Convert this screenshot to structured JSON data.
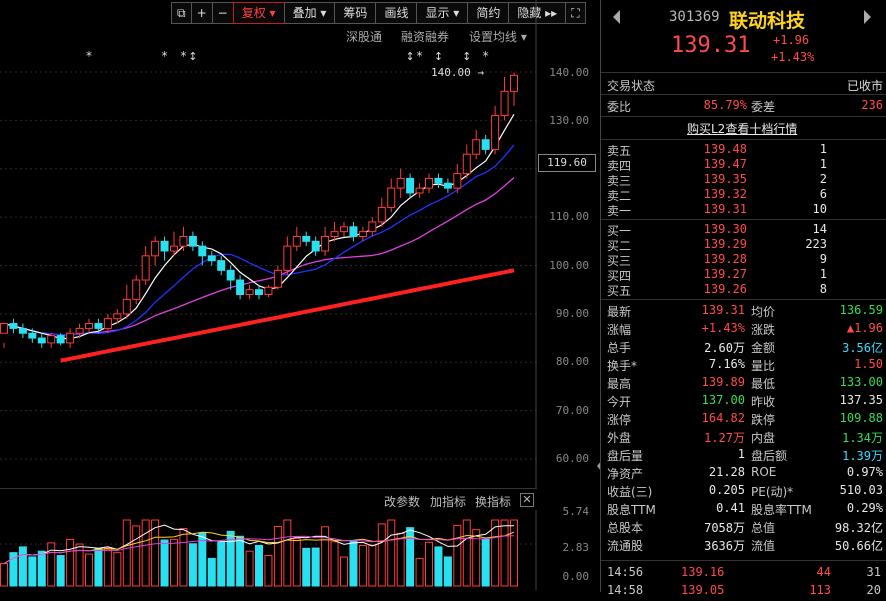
{
  "toolbar": {
    "icons": [
      "restore-icon",
      "plus-icon",
      "minus-icon"
    ],
    "items": [
      "复权",
      "叠加",
      "筹码",
      "画线",
      "显示",
      "简约",
      "隐藏"
    ],
    "active": "复权"
  },
  "subbar": {
    "items": [
      "深股通",
      "融资融券",
      "设置均线"
    ]
  },
  "chart": {
    "price_ticks": [
      "140.00",
      "130.00",
      "120.00",
      "110.00",
      "100.00",
      "90.00",
      "80.00",
      "70.00",
      "60.00"
    ],
    "current_price_box": "119.60",
    "high_annotation": "140.00",
    "volume_ticks": [
      "5.74",
      "2.83",
      "0.00"
    ],
    "sub_links": [
      "改参数",
      "加指标",
      "换指标"
    ],
    "colors": {
      "up": "#ff3b3b",
      "down": "#28e0f0",
      "ma5": "#ffffff",
      "ma10": "#2233ff",
      "ma20": "#e040e0",
      "ma60": "#ff2020"
    }
  },
  "chart_data": {
    "type": "candlestick",
    "ylim": [
      55,
      145
    ],
    "candles": [
      [
        86,
        88,
        84,
        83
      ],
      [
        88,
        87,
        89,
        86
      ],
      [
        87,
        86,
        88,
        85
      ],
      [
        86,
        85,
        87,
        84
      ],
      [
        85,
        84,
        86,
        83
      ],
      [
        84,
        85.5,
        86,
        83
      ],
      [
        85.5,
        84,
        86,
        83.5
      ],
      [
        84,
        86,
        87,
        83
      ],
      [
        86,
        87,
        88,
        85
      ],
      [
        87,
        88,
        89,
        86
      ],
      [
        88,
        87,
        89,
        86
      ],
      [
        87,
        89,
        90,
        86
      ],
      [
        89,
        90,
        91,
        88
      ],
      [
        90,
        93,
        96,
        89
      ],
      [
        93,
        97,
        98,
        92
      ],
      [
        97,
        102,
        104,
        96
      ],
      [
        102,
        105,
        106,
        100
      ],
      [
        105,
        103,
        106,
        101
      ],
      [
        103,
        104,
        107,
        102
      ],
      [
        104,
        106,
        108,
        103
      ],
      [
        106,
        104,
        107,
        103
      ],
      [
        104,
        102,
        105,
        100
      ],
      [
        102,
        101,
        103,
        100
      ],
      [
        101,
        99,
        102,
        98
      ],
      [
        99,
        97,
        100,
        95
      ],
      [
        97,
        94,
        98,
        93
      ],
      [
        94,
        95,
        96,
        93
      ],
      [
        95,
        94,
        96,
        93
      ],
      [
        94,
        95.5,
        96,
        93.5
      ],
      [
        95.5,
        99,
        100,
        95
      ],
      [
        99,
        104,
        106,
        98
      ],
      [
        104,
        106,
        108,
        103
      ],
      [
        106,
        105,
        107,
        104
      ],
      [
        105,
        103,
        106,
        102
      ],
      [
        103,
        106,
        108,
        102
      ],
      [
        106,
        107,
        109,
        105
      ],
      [
        107,
        108,
        109,
        106
      ],
      [
        108,
        106,
        109,
        105
      ],
      [
        106,
        107,
        108,
        105
      ],
      [
        107,
        109,
        110,
        106
      ],
      [
        109,
        112,
        114,
        108
      ],
      [
        112,
        116,
        118,
        111
      ],
      [
        116,
        118,
        120,
        114
      ],
      [
        118,
        115,
        119,
        114
      ],
      [
        115,
        116,
        117,
        114
      ],
      [
        116,
        118,
        119,
        115
      ],
      [
        118,
        117,
        119,
        116
      ],
      [
        117,
        116,
        118,
        115
      ],
      [
        116,
        119,
        121,
        115
      ],
      [
        119,
        123,
        125,
        118
      ],
      [
        123,
        126,
        128,
        122
      ],
      [
        126,
        124,
        127,
        123
      ],
      [
        124,
        131,
        133,
        123
      ],
      [
        131,
        136,
        139,
        130
      ],
      [
        136,
        139.31,
        139.89,
        133
      ]
    ],
    "asterisks": [
      9,
      17,
      19,
      44,
      51,
      60
    ],
    "arrows": [
      20,
      43,
      46,
      49
    ],
    "volume_max": 5.74
  },
  "stock": {
    "code": "301369",
    "name": "联动科技",
    "price": "139.31",
    "change": "+1.96",
    "change_pct": "+1.43%"
  },
  "status": {
    "label": "交易状态",
    "value": "已收市"
  },
  "ratio": {
    "label1": "委比",
    "value1": "85.79%",
    "label2": "委差",
    "value2": "236"
  },
  "l2_link": "购买L2查看十档行情",
  "asks": [
    {
      "label": "卖五",
      "price": "139.48",
      "vol": "1"
    },
    {
      "label": "卖四",
      "price": "139.47",
      "vol": "1"
    },
    {
      "label": "卖三",
      "price": "139.35",
      "vol": "2"
    },
    {
      "label": "卖二",
      "price": "139.32",
      "vol": "6"
    },
    {
      "label": "卖一",
      "price": "139.31",
      "vol": "10"
    }
  ],
  "bids": [
    {
      "label": "买一",
      "price": "139.30",
      "vol": "14"
    },
    {
      "label": "买二",
      "price": "139.29",
      "vol": "223"
    },
    {
      "label": "买三",
      "price": "139.28",
      "vol": "9"
    },
    {
      "label": "买四",
      "price": "139.27",
      "vol": "1"
    },
    {
      "label": "买五",
      "price": "139.26",
      "vol": "8"
    }
  ],
  "stats": [
    {
      "l1": "最新",
      "v1": "139.31",
      "c1": "red",
      "l2": "均价",
      "v2": "136.59",
      "c2": "green"
    },
    {
      "l1": "涨幅",
      "v1": "+1.43%",
      "c1": "red",
      "l2": "涨跌",
      "v2": "▲1.96",
      "c2": "red"
    },
    {
      "l1": "总手",
      "v1": "2.60万",
      "c1": "white",
      "l2": "金额",
      "v2": "3.56亿",
      "c2": "cyan"
    },
    {
      "l1": "换手*",
      "v1": "7.16%",
      "c1": "white",
      "l2": "量比",
      "v2": "1.50",
      "c2": "red"
    },
    {
      "l1": "最高",
      "v1": "139.89",
      "c1": "red",
      "l2": "最低",
      "v2": "133.00",
      "c2": "green"
    },
    {
      "l1": "今开",
      "v1": "137.00",
      "c1": "green",
      "l2": "昨收",
      "v2": "137.35",
      "c2": "white"
    },
    {
      "l1": "涨停",
      "v1": "164.82",
      "c1": "red",
      "l2": "跌停",
      "v2": "109.88",
      "c2": "green"
    },
    {
      "l1": "外盘",
      "v1": "1.27万",
      "c1": "red",
      "l2": "内盘",
      "v2": "1.34万",
      "c2": "green"
    },
    {
      "l1": "盘后量",
      "v1": "1",
      "c1": "white",
      "l2": "盘后额",
      "v2": "1.39万",
      "c2": "cyan"
    },
    {
      "l1": "净资产",
      "v1": "21.28",
      "c1": "white",
      "l2": "ROE",
      "v2": "0.97%",
      "c2": "white"
    },
    {
      "l1": "收益(三)",
      "v1": "0.205",
      "c1": "white",
      "l2": "PE(动)*",
      "v2": "510.03",
      "c2": "white"
    },
    {
      "l1": "股息TTM",
      "v1": "0.41",
      "c1": "white",
      "l2": "股息率TTM",
      "v2": "0.29%",
      "c2": "white"
    },
    {
      "l1": "总股本",
      "v1": "7058万",
      "c1": "white",
      "l2": "总值",
      "v2": "98.32亿",
      "c2": "white"
    },
    {
      "l1": "流通股",
      "v1": "3636万",
      "c1": "white",
      "l2": "流值",
      "v2": "50.66亿",
      "c2": "white"
    }
  ],
  "ticks": [
    {
      "time": "14:56",
      "price": "139.16",
      "vol": "44",
      "n": "31"
    },
    {
      "time": "14:58",
      "price": "139.05",
      "vol": "113",
      "n": "20"
    }
  ]
}
